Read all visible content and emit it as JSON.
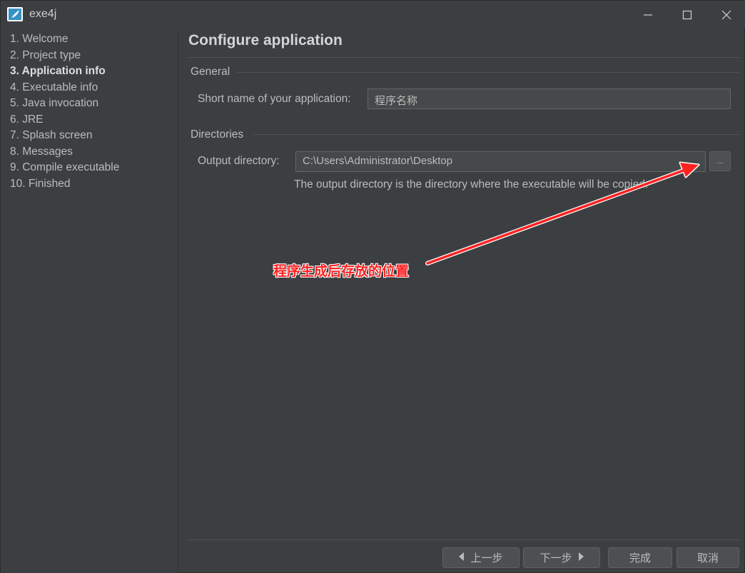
{
  "window": {
    "title": "exe4j"
  },
  "sidebar": {
    "items": [
      {
        "label": "1. Welcome",
        "active": false
      },
      {
        "label": "2. Project type",
        "active": false
      },
      {
        "label": "3. Application info",
        "active": true
      },
      {
        "label": "4. Executable info",
        "active": false
      },
      {
        "label": "5. Java invocation",
        "active": false
      },
      {
        "label": "6. JRE",
        "active": false
      },
      {
        "label": "7. Splash screen",
        "active": false
      },
      {
        "label": "8. Messages",
        "active": false
      },
      {
        "label": "9. Compile executable",
        "active": false
      },
      {
        "label": "10. Finished",
        "active": false
      }
    ]
  },
  "main": {
    "title": "Configure application",
    "general": {
      "heading": "General",
      "short_name_label": "Short name of your application:",
      "short_name_value": "程序名称"
    },
    "directories": {
      "heading": "Directories",
      "output_label": "Output directory:",
      "output_value": "C:\\Users\\Administrator\\Desktop",
      "browse_label": "...",
      "hint": "The output directory is the directory where the executable will be copied."
    }
  },
  "annotation": {
    "text": "程序生成后存放的位置",
    "color": "#ff2020"
  },
  "buttons": {
    "back": "上一步",
    "next": "下一步",
    "finish": "完成",
    "cancel": "取消"
  },
  "colors": {
    "background": "#3c3f41",
    "text": "#bbbbbb",
    "field_bg": "#45494a",
    "accent_icon": "#3592c4"
  }
}
